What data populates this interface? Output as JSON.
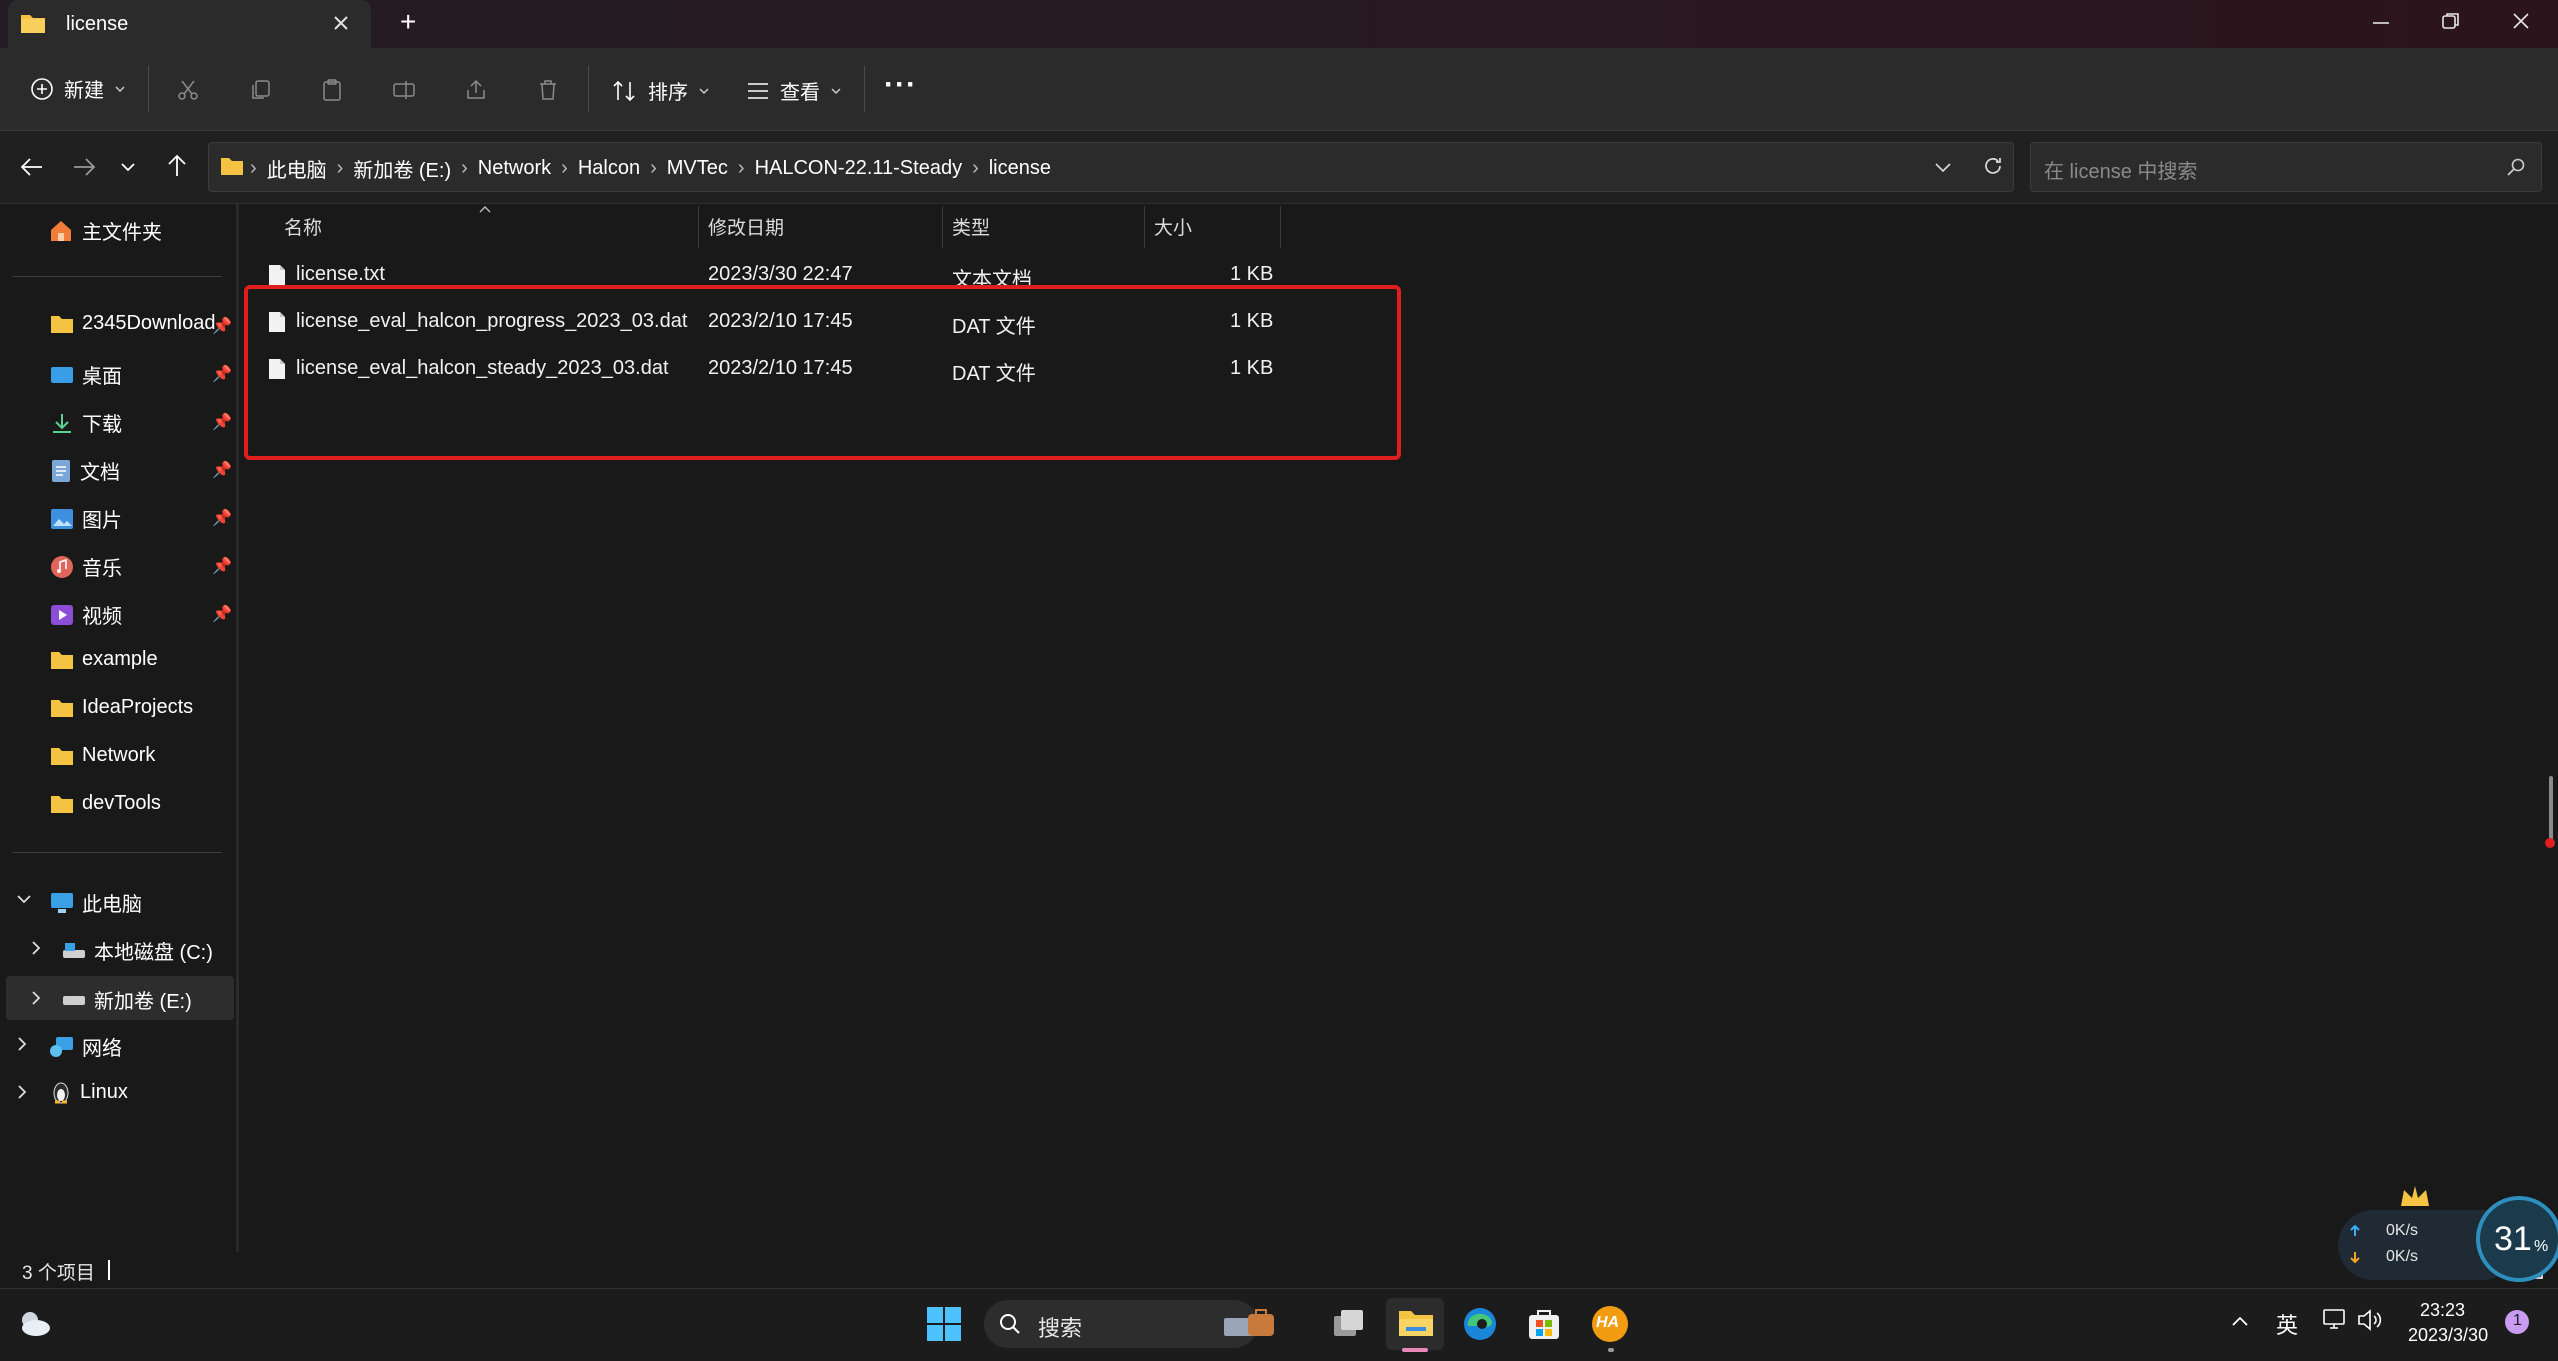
{
  "window": {
    "tab_title": "license",
    "new_tab_symbol": "+"
  },
  "toolbar": {
    "new_label": "新建",
    "sort_label": "排序",
    "view_label": "查看",
    "more_label": "···"
  },
  "address": {
    "crumbs": [
      "此电脑",
      "新加卷 (E:)",
      "Network",
      "Halcon",
      "MVTec",
      "HALCON-22.11-Steady",
      "license"
    ],
    "search_placeholder": "在 license 中搜索"
  },
  "sidebar": {
    "home": "主文件夹",
    "quick": [
      {
        "label": "2345Download",
        "icon": "folder-icon"
      },
      {
        "label": "桌面",
        "icon": "desktop-icon"
      },
      {
        "label": "下载",
        "icon": "download-icon"
      },
      {
        "label": "文档",
        "icon": "document-icon"
      },
      {
        "label": "图片",
        "icon": "picture-icon"
      },
      {
        "label": "音乐",
        "icon": "music-icon"
      },
      {
        "label": "视频",
        "icon": "video-icon"
      },
      {
        "label": "example",
        "icon": "folder-icon"
      },
      {
        "label": "IdeaProjects",
        "icon": "folder-icon"
      },
      {
        "label": "Network",
        "icon": "folder-icon"
      },
      {
        "label": "devTools",
        "icon": "folder-icon"
      }
    ],
    "this_pc": "此电脑",
    "drive_c": "本地磁盘 (C:)",
    "drive_e": "新加卷 (E:)",
    "network": "网络",
    "linux": "Linux"
  },
  "columns": {
    "name": "名称",
    "modified": "修改日期",
    "type": "类型",
    "size": "大小"
  },
  "files": [
    {
      "name": "license.txt",
      "modified": "2023/3/30 22:47",
      "type": "文本文档",
      "size": "1 KB"
    },
    {
      "name": "license_eval_halcon_progress_2023_03.dat",
      "modified": "2023/2/10 17:45",
      "type": "DAT 文件",
      "size": "1 KB"
    },
    {
      "name": "license_eval_halcon_steady_2023_03.dat",
      "modified": "2023/2/10 17:45",
      "type": "DAT 文件",
      "size": "1 KB"
    }
  ],
  "status": {
    "item_count": "3 个项目"
  },
  "taskbar": {
    "search_label": "搜索",
    "ime": "英",
    "time": "23:23",
    "date": "2023/3/30",
    "notification_count": "1",
    "app_badge": "HA"
  },
  "widget": {
    "upload": "0K/s",
    "download": "0K/s",
    "percent": "31",
    "percent_sign": "%",
    "badge": "VIP"
  },
  "colors": {
    "highlight_border": "#e01e1e",
    "folder": "#f5c342",
    "accent_blue": "#4aa3df"
  }
}
